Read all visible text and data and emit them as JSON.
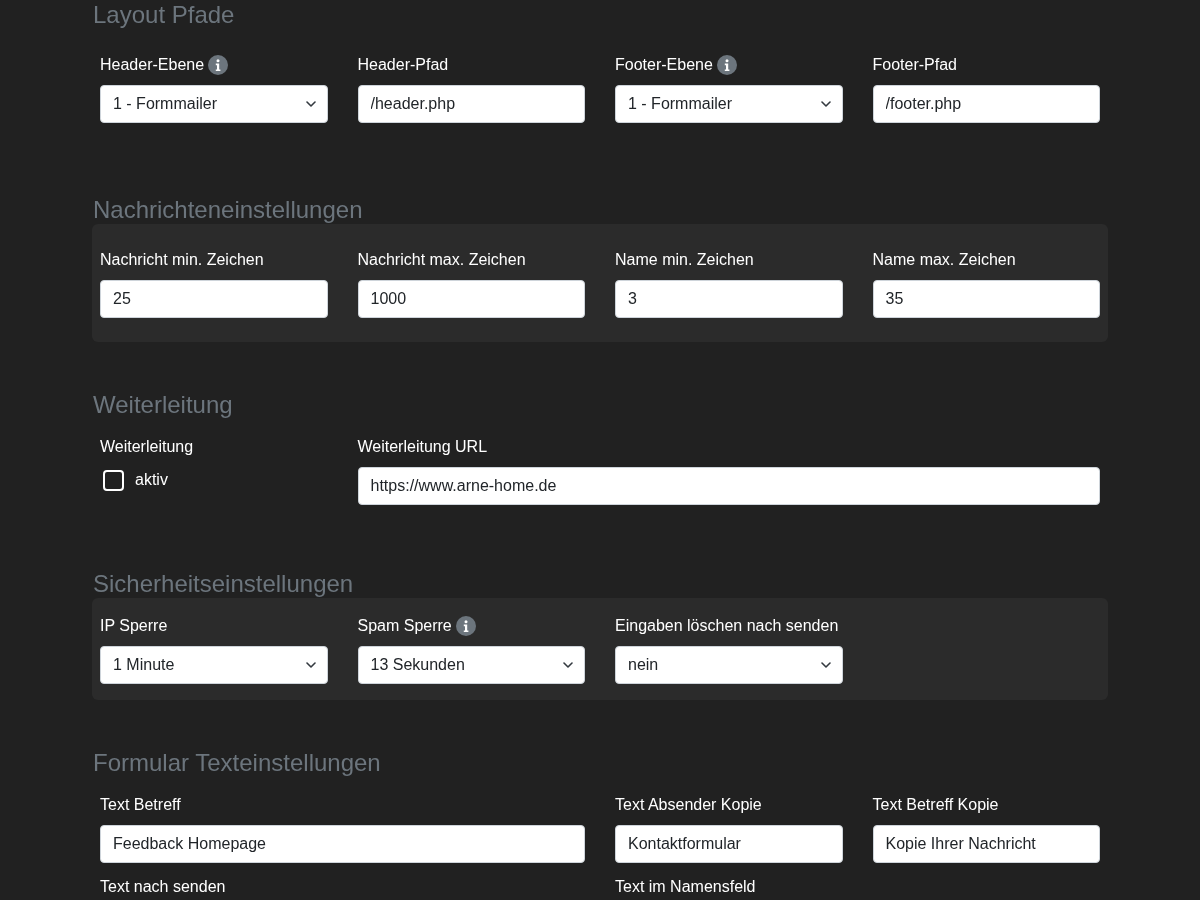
{
  "sections": [
    {
      "title": "Layout Pfade",
      "fields": [
        {
          "label": "Header-Ebene",
          "info": true,
          "kind": "select",
          "value": "1 - Formmailer"
        },
        {
          "label": "Header-Pfad",
          "info": false,
          "kind": "text",
          "value": "/header.php"
        },
        {
          "label": "Footer-Ebene",
          "info": true,
          "kind": "select",
          "value": "1 - Formmailer"
        },
        {
          "label": "Footer-Pfad",
          "info": false,
          "kind": "text",
          "value": "/footer.php"
        }
      ]
    },
    {
      "title": "Nachrichteneinstellungen",
      "fields": [
        {
          "label": "Nachricht min. Zeichen",
          "info": false,
          "kind": "text",
          "value": "25"
        },
        {
          "label": "Nachricht max. Zeichen",
          "info": false,
          "kind": "text",
          "value": "1000"
        },
        {
          "label": "Name min. Zeichen",
          "info": false,
          "kind": "text",
          "value": "3"
        },
        {
          "label": "Name max. Zeichen",
          "info": false,
          "kind": "text",
          "value": "35"
        }
      ]
    },
    {
      "title": "Weiterleitung",
      "fields": [
        {
          "label": "Weiterleitung",
          "info": false,
          "kind": "checkbox",
          "option": "aktiv",
          "checked": false
        },
        {
          "label": "Weiterleitung URL",
          "info": false,
          "kind": "text",
          "value": "https://www.arne-home.de"
        }
      ]
    },
    {
      "title": "Sicherheitseinstellungen",
      "fields": [
        {
          "label": "IP Sperre",
          "info": false,
          "kind": "select",
          "value": "1 Minute"
        },
        {
          "label": "Spam Sperre",
          "info": true,
          "kind": "select",
          "value": "13 Sekunden"
        },
        {
          "label": "Eingaben löschen nach senden",
          "info": false,
          "kind": "select",
          "value": "nein"
        }
      ]
    },
    {
      "title": "Formular Texteinstellungen",
      "fields": [
        {
          "label": "Text Betreff",
          "info": false,
          "kind": "text",
          "value": "Feedback Homepage"
        },
        {
          "label": "Text Absender Kopie",
          "info": false,
          "kind": "text",
          "value": "Kontaktformular"
        },
        {
          "label": "Text Betreff Kopie",
          "info": false,
          "kind": "text",
          "value": "Kopie Ihrer Nachricht"
        },
        {
          "label": "Text nach senden",
          "info": false,
          "kind": "label"
        },
        {
          "label": "Text im Namensfeld",
          "info": false,
          "kind": "label"
        }
      ]
    }
  ]
}
